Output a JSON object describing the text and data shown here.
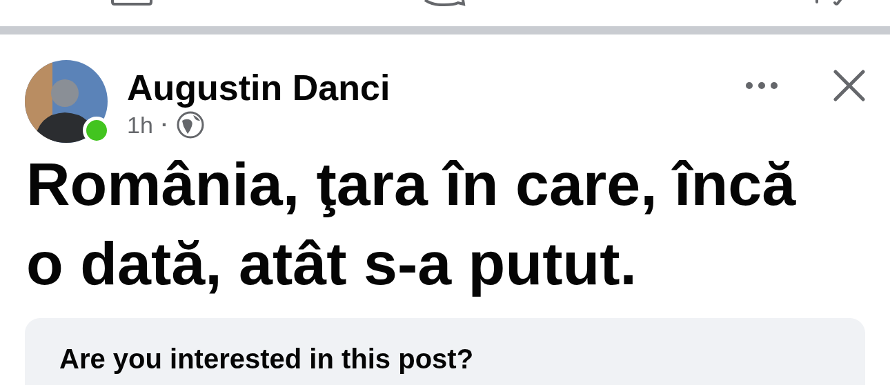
{
  "post": {
    "author": {
      "name": "Augustin Danci",
      "online": true
    },
    "time": "1h",
    "separator": "·",
    "text": "România, ţara în care, încă o dată, atât s-a putut."
  },
  "prompt": {
    "question": "Are you interested in this post?"
  }
}
